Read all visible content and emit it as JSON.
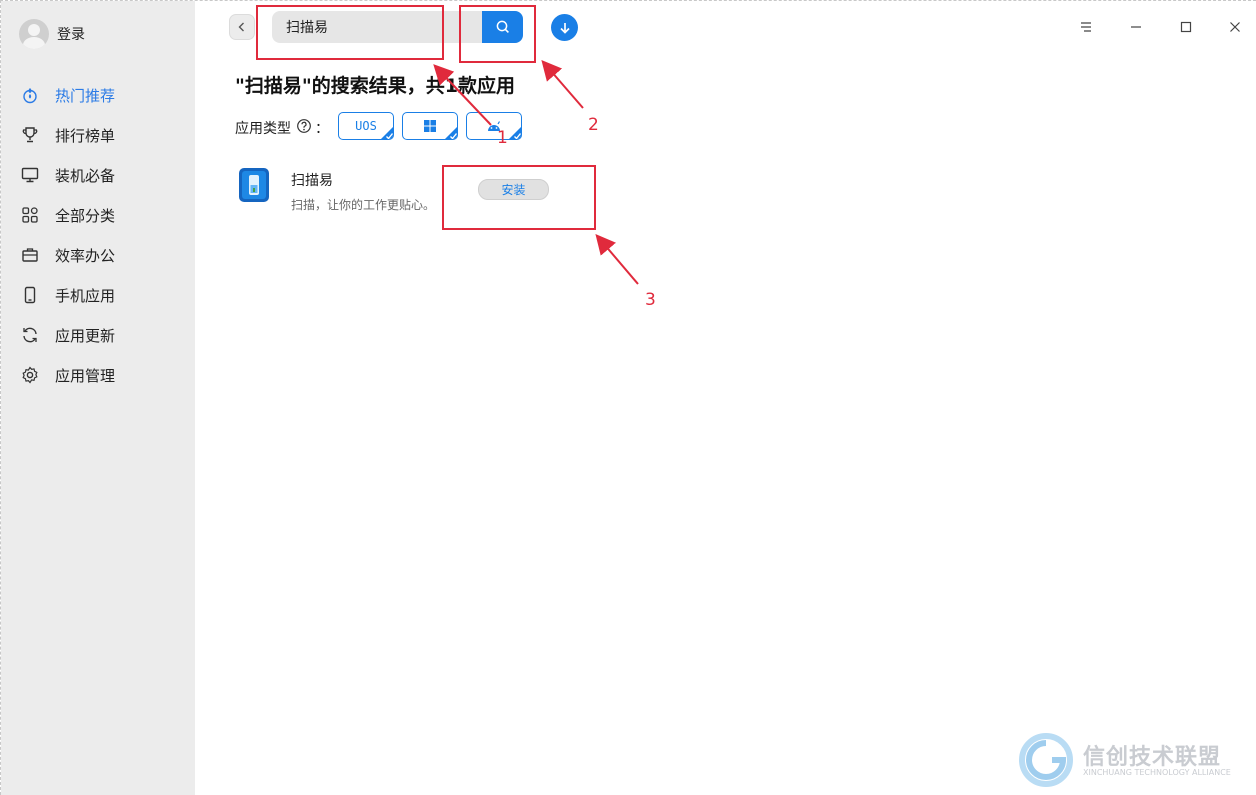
{
  "sidebar": {
    "login_label": "登录",
    "items": [
      {
        "label": "热门推荐",
        "icon": "flame-icon"
      },
      {
        "label": "排行榜单",
        "icon": "trophy-icon"
      },
      {
        "label": "装机必备",
        "icon": "monitor-icon"
      },
      {
        "label": "全部分类",
        "icon": "grid-icon"
      },
      {
        "label": "效率办公",
        "icon": "briefcase-icon"
      },
      {
        "label": "手机应用",
        "icon": "phone-icon"
      },
      {
        "label": "应用更新",
        "icon": "refresh-icon"
      },
      {
        "label": "应用管理",
        "icon": "gear-icon"
      }
    ],
    "active_index": 0
  },
  "header": {
    "search_value": "扫描易"
  },
  "results": {
    "title": "\"扫描易\"的搜索结果，共1款应用",
    "filter_label": "应用类型",
    "filter_colon": "：",
    "chips": [
      {
        "label": "UOS",
        "icon": "uos-icon",
        "checked": true
      },
      {
        "label": "",
        "icon": "windows-icon",
        "checked": true
      },
      {
        "label": "",
        "icon": "android-icon",
        "checked": true
      }
    ],
    "apps": [
      {
        "name": "扫描易",
        "description": "扫描，让你的工作更贴心。",
        "install_label": "安装"
      }
    ]
  },
  "annotations": {
    "labels": [
      "1",
      "2",
      "3"
    ],
    "color": "#e02a3c"
  },
  "watermark": {
    "title": "信创技术联盟",
    "subtitle": "XINCHUANG TECHNOLOGY ALLIANCE"
  },
  "colors": {
    "accent": "#1a7fe6",
    "sidebar_bg": "#ececec"
  }
}
